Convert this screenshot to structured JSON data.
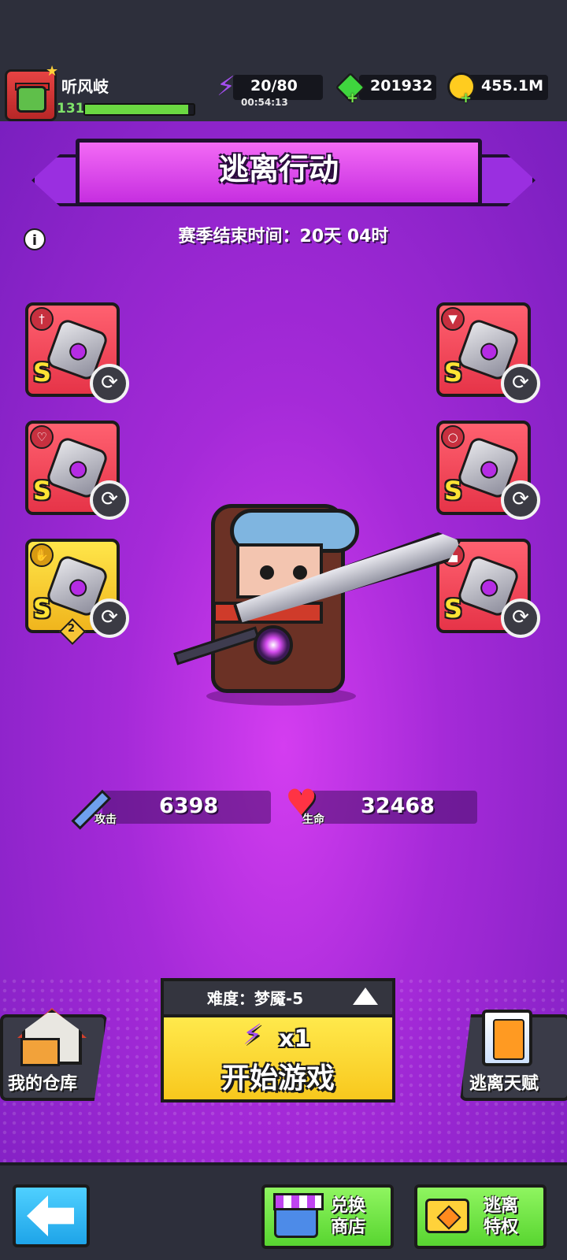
{
  "player": {
    "name": "听风岐",
    "level": "131",
    "xp_fraction": 0.95
  },
  "resources": {
    "energy": "20/80",
    "energy_timer": "00:54:13",
    "gems": "201932",
    "coins": "455.1M"
  },
  "event": {
    "title": "逃离行动",
    "season_end": "赛季结束时间：20天 04时"
  },
  "equipment": {
    "left": [
      {
        "slot": "weapon",
        "rank": "S",
        "icon": "weapon-type-icon",
        "rarity": "red"
      },
      {
        "slot": "necklace",
        "rank": "S",
        "icon": "necklace-type-icon",
        "rarity": "red"
      },
      {
        "slot": "gloves",
        "rank": "S",
        "icon": "glove-type-icon",
        "rarity": "gold",
        "level": "2"
      }
    ],
    "right": [
      {
        "slot": "armor",
        "rank": "S",
        "icon": "armor-type-icon",
        "rarity": "red"
      },
      {
        "slot": "ring",
        "rank": "S",
        "icon": "ring-type-icon",
        "rarity": "red"
      },
      {
        "slot": "boots",
        "rank": "S",
        "icon": "boot-type-icon",
        "rarity": "red"
      }
    ]
  },
  "stats": {
    "attack_label": "攻击",
    "attack_value": "6398",
    "hp_label": "生命",
    "hp_value": "32468"
  },
  "actions": {
    "warehouse_label": "我的仓库",
    "difficulty": "难度：梦魇-5",
    "start_cost": "x1",
    "start_label": "开始游戏",
    "talent_label": "逃离天赋"
  },
  "nav": {
    "exchange_label": "兑换\n商店",
    "exchange_line1": "兑换",
    "exchange_line2": "商店",
    "privilege_line1": "逃离",
    "privilege_line2": "特权"
  },
  "colors": {
    "background_purple": "#a52ad8",
    "banner_pink": "#e64ef0",
    "start_yellow": "#f8c81d",
    "nav_green": "#58d530",
    "back_blue": "#1ea4e8"
  }
}
